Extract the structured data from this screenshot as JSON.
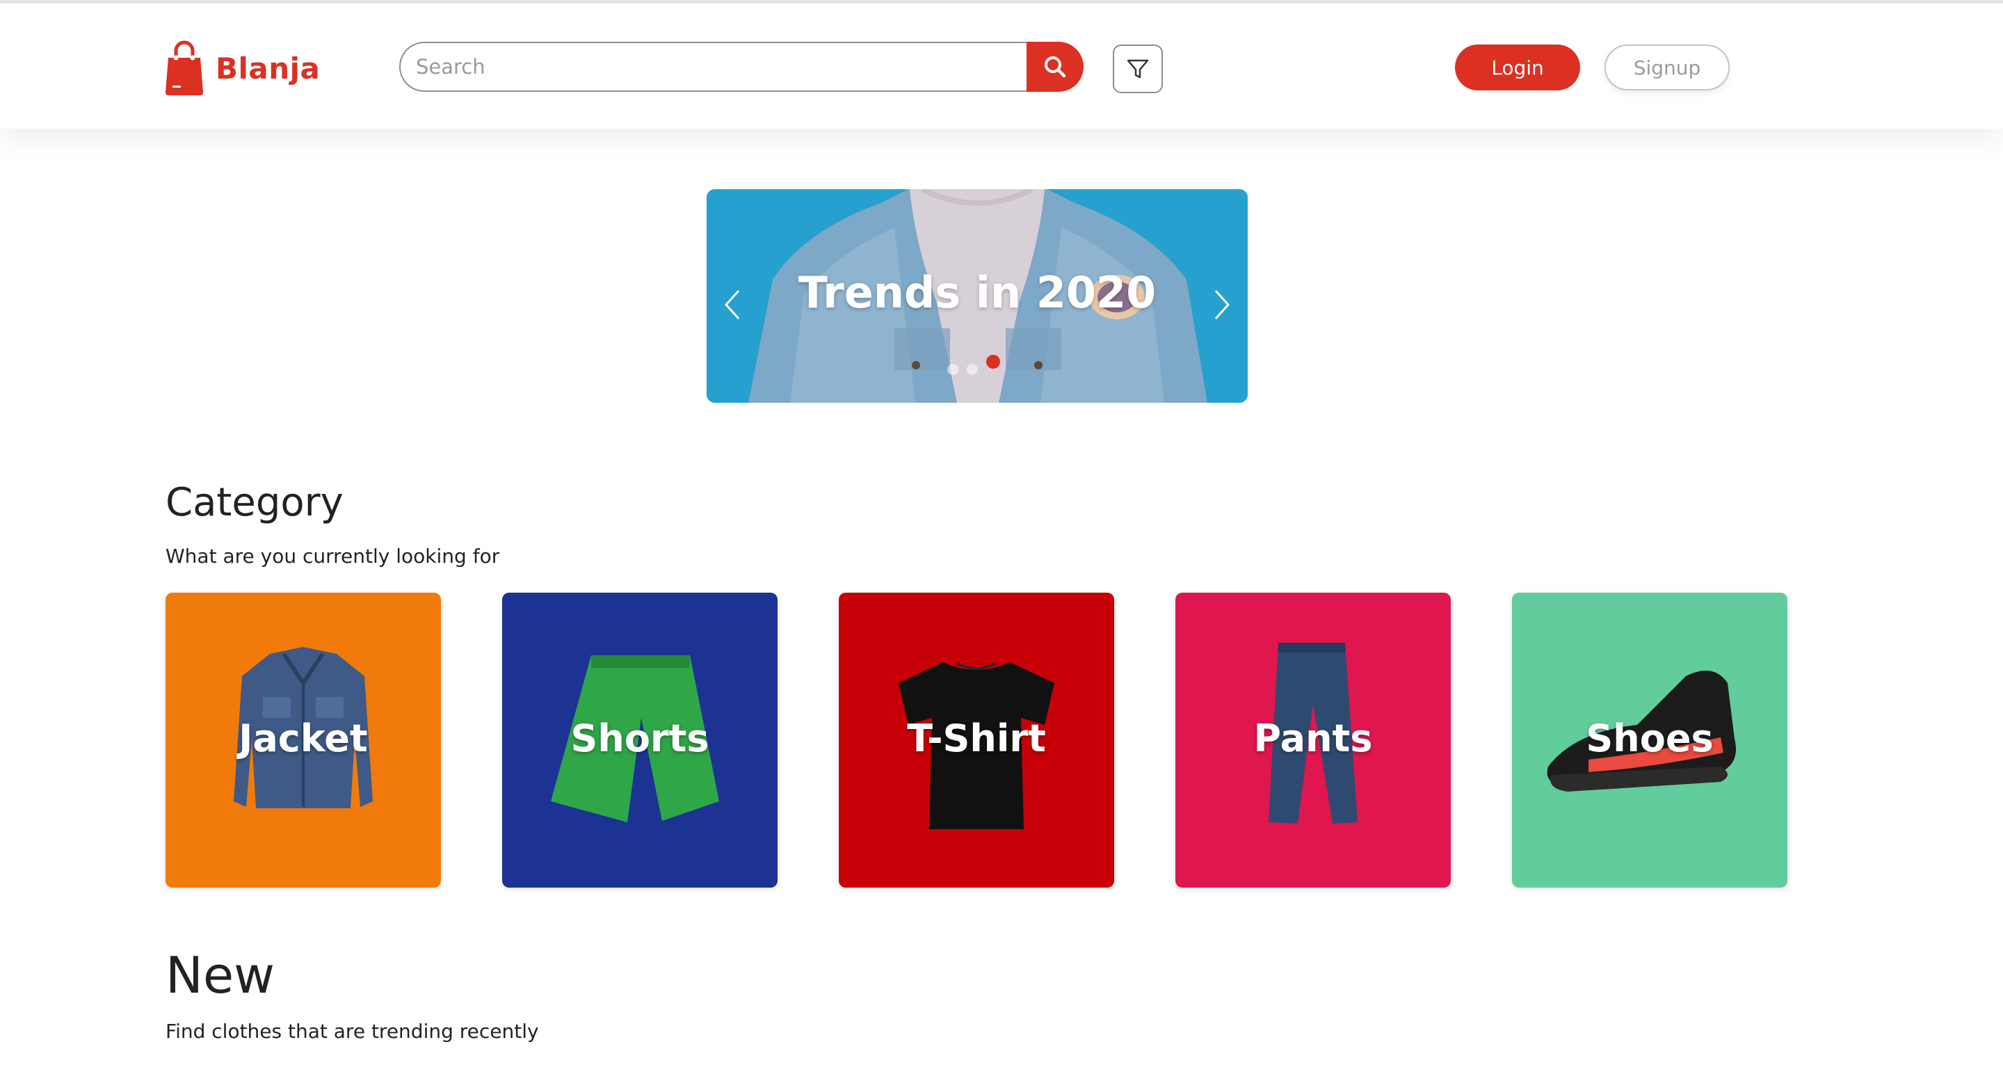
{
  "header": {
    "brand": "Blanja",
    "search": {
      "placeholder": "Search",
      "value": ""
    },
    "login_label": "Login",
    "signup_label": "Signup"
  },
  "carousel": {
    "title": "Trends in 2020",
    "slides_count": 3,
    "active_slide": 3
  },
  "category": {
    "title": "Category",
    "subtitle": "What are you currently looking for",
    "items": [
      {
        "label": "Jacket",
        "color": "#f07b0a",
        "icon": "jacket-image"
      },
      {
        "label": "Shorts",
        "color": "#1c3394",
        "icon": "shorts-image"
      },
      {
        "label": "T-Shirt",
        "color": "#c70007",
        "icon": "tshirt-image"
      },
      {
        "label": "Pants",
        "color": "#e0164e",
        "icon": "pants-image"
      },
      {
        "label": "Shoes",
        "color": "#62cd9c",
        "icon": "shoes-image"
      }
    ]
  },
  "new": {
    "title": "New",
    "subtitle": "Find clothes that are trending recently"
  },
  "colors": {
    "brand": "#db3022",
    "text": "#222222",
    "border": "#8e8e8e"
  }
}
